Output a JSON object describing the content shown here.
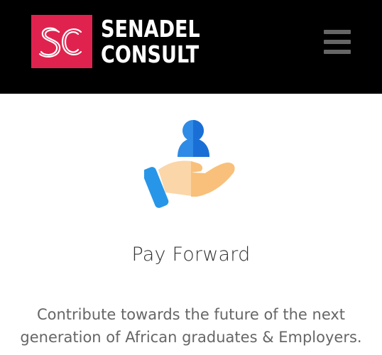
{
  "brand": {
    "line1": "SENADEL",
    "line2": "CONSULT",
    "accent_color": "#e0234e",
    "monogram": "SC"
  },
  "header": {
    "menu_icon": "hamburger-menu-icon"
  },
  "feature": {
    "icon": "hand-holding-person-icon",
    "title": "Pay Forward",
    "description_line1": "Contribute towards the future of the next",
    "description_line2": "generation of African graduates & Employers."
  }
}
